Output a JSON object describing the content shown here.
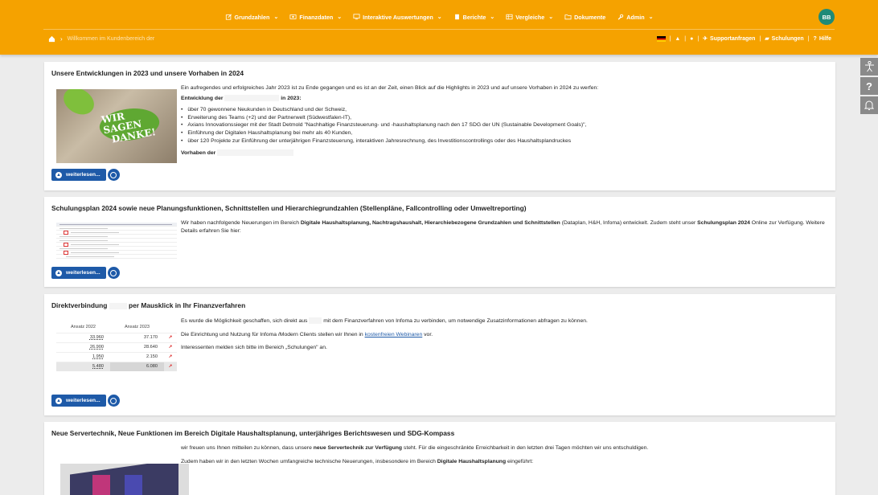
{
  "nav": {
    "items": [
      {
        "label": "Grundzahlen",
        "icon": "edit-icon",
        "has_dropdown": true
      },
      {
        "label": "Finanzdaten",
        "icon": "currency-icon",
        "has_dropdown": true
      },
      {
        "label": "Interaktive Auswertungen",
        "icon": "monitor-icon",
        "has_dropdown": true
      },
      {
        "label": "Berichte",
        "icon": "book-icon",
        "has_dropdown": true
      },
      {
        "label": "Vergleiche",
        "icon": "table-icon",
        "has_dropdown": true
      },
      {
        "label": "Dokumente",
        "icon": "folder-icon",
        "has_dropdown": false
      },
      {
        "label": "Admin",
        "icon": "wrench-icon",
        "has_dropdown": true
      }
    ],
    "avatar": "BB"
  },
  "breadcrumb": {
    "text": "Willkommen im Kundenbereich der"
  },
  "toplinks": {
    "support": "Supportanfragen",
    "training": "Schulungen",
    "help": "Hilfe"
  },
  "colors": {
    "brand": "#f5a200",
    "accent": "#1e5aa8",
    "avatar": "#1e8a77"
  },
  "cards": [
    {
      "title": "Unsere Entwicklungen in 2023 und unsere Vorhaben in 2024",
      "thumb_text": [
        "WIR SAGEN",
        "DANKE!"
      ],
      "intro": "Ein aufregendes und erfolgreiches Jahr 2023 ist zu Ende gegangen und es ist an der Zeit, einen Blick auf die Highlights in 2023 und auf unsere Vorhaben in 2024 zu werfen:",
      "sub1_a": "Entwicklung der",
      "sub1_b": "in 2023:",
      "bullets": [
        "über 70 gewonnene Neukunden in Deutschland und der Schweiz,",
        "Erweiterung des Teams (+2) und der Partnerwelt (Südwestfalen-IT),",
        "Axians Innovationssieger mit der Stadt Detmold \"Nachhaltige Finanzsteuerung- und -haushaltsplanung nach den 17 SDG der UN (Sustainable Development Goals)\",",
        "Einführung der Digitalen Haushaltsplanung bei mehr als 40 Kunden,",
        "über 120 Projekte zur Einführung der unterjährigen Finanzsteuerung, interaktiven Jahresrechnung, des Investitionscontrollings oder des Haushaltsplandruckes"
      ],
      "sub2": "Vorhaben der",
      "more": "weiterlesen..."
    },
    {
      "title": "Schulungsplan 2024 sowie neue Planungsfunktionen, Schnittstellen und Hierarchiegrundzahlen (Stellenpläne, Fallcontrolling oder Umweltreporting)",
      "p1": "Wir haben nachfolgende Neuerungen im Bereich",
      "p1_b": "Digitale Haushaltsplanung, Nachtragshaushalt, Hierarchiebezogene Grundzahlen und Schnittstellen",
      "p1_c": "(Dataplan, H&H, Infoma) entwickelt. Zudem steht unser",
      "p1_d": "Schulungsplan 2024",
      "p1_e": "Online zur Verfügung. Weitere Details erfahren Sie hier:",
      "more": "weiterlesen..."
    },
    {
      "title_a": "Direktverbindung",
      "title_b": "per Mausklick in Ihr Finanzverfahren",
      "table": {
        "headers": [
          "Ansatz 2022",
          "Ansatz 2023"
        ],
        "rows": [
          [
            "33.960",
            "37.170"
          ],
          [
            "26.900",
            "28.640"
          ],
          [
            "1.950",
            "2.150"
          ],
          [
            "5.480",
            "6.080"
          ]
        ]
      },
      "p1_a": "Es wurde die Möglichkeit geschaffen, sich direkt aus",
      "p1_b": "mit dem Finanzverfahren von Infoma zu verbinden, um notwendige Zusatzinformationen abfragen zu können.",
      "p2_a": "Die Einrichtung und Nutzung für Infoma /Modern Clients stellen wir Ihnen in",
      "p2_link": "kostenfreien Webinaren",
      "p2_b": "vor.",
      "p3": "Interessenten melden sich bitte im Bereich „Schulungen\" an.",
      "more": "weiterlesen..."
    },
    {
      "title": "Neue Servertechnik, Neue Funktionen im Bereich Digitale Haushaltsplanung, unterjähriges Berichtswesen und SDG-Kompass",
      "p1_a": "wir freuen uns Ihnen mitteilen zu können, dass unsere",
      "p1_b": "neue Servertechnik zur Verfügung",
      "p1_c": "steht. Für die eingeschränkte Erreichbarkeit in den letzten drei Tagen möchten wir uns entschuldigen.",
      "p2_a": "Zudem haben wir in den letzten Wochen umfangreiche technische Neuerungen, insbesondere im Bereich",
      "p2_b": "Digitale Haushaltsplanung",
      "p2_c": "eingeführt:"
    }
  ]
}
